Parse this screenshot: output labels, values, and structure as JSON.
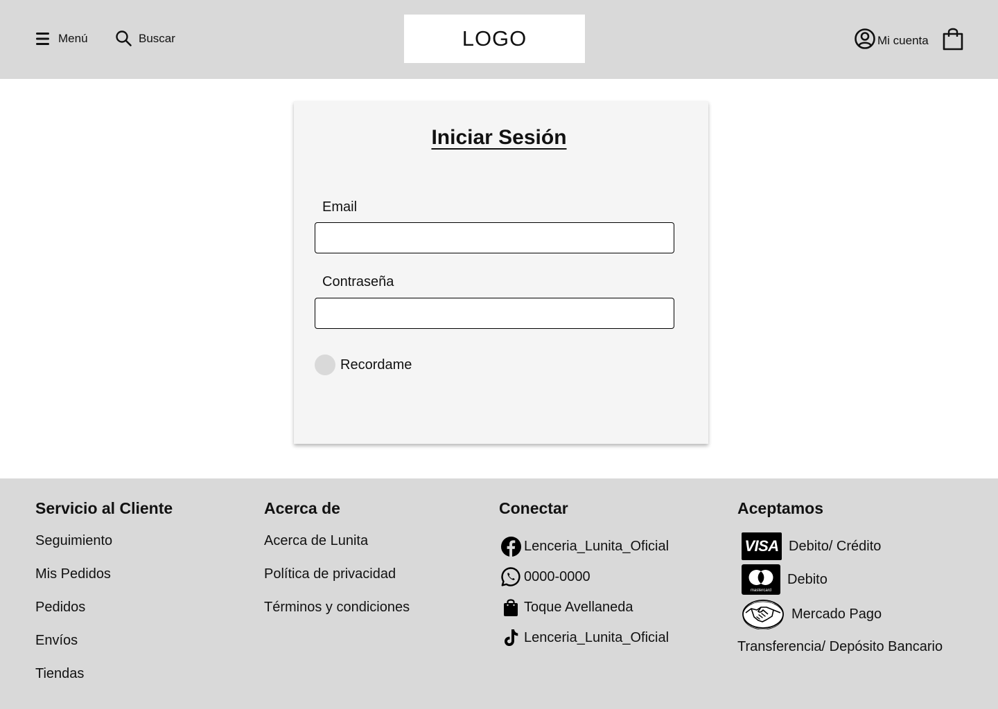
{
  "header": {
    "menu_label": "Menú",
    "search_label": "Buscar",
    "logo_text": "LOGO",
    "account_label": "Mi cuenta"
  },
  "login": {
    "title": "Iniciar Sesión",
    "email_label": "Email",
    "email_value": "",
    "password_label": "Contraseña",
    "password_value": "",
    "remember_label": "Recordame"
  },
  "footer": {
    "customer_service": {
      "title": "Servicio al Cliente",
      "links": [
        "Seguimiento",
        "Mis Pedidos",
        "Pedidos",
        "Envíos",
        "Tiendas"
      ]
    },
    "about": {
      "title": "Acerca de",
      "links": [
        "Acerca de Lunita",
        "Política de privacidad",
        "Términos y condiciones"
      ]
    },
    "connect": {
      "title": "Conectar",
      "items": [
        {
          "icon": "facebook-icon",
          "label": "Lenceria_Lunita_Oficial"
        },
        {
          "icon": "whatsapp-icon",
          "label": "0000-0000"
        },
        {
          "icon": "shopping-bag-icon",
          "label": "Toque Avellaneda"
        },
        {
          "icon": "tiktok-icon",
          "label": "Lenceria_Lunita_Oficial"
        }
      ]
    },
    "payments": {
      "title": "Aceptamos",
      "items": [
        {
          "icon": "visa-icon",
          "badge_text": "VISA",
          "label": "Debito/ Crédito"
        },
        {
          "icon": "mastercard-icon",
          "badge_text": "mastercard",
          "label": "Debito"
        },
        {
          "icon": "handshake-icon",
          "label": "Mercado Pago"
        }
      ],
      "transfer_label": "Transferencia/ Depósito Bancario"
    }
  },
  "colors": {
    "header_bg": "#d9d9d9",
    "footer_bg": "#d9d9d9",
    "card_bg": "#f5f5f5",
    "radio_fill": "#d9d9d9"
  }
}
